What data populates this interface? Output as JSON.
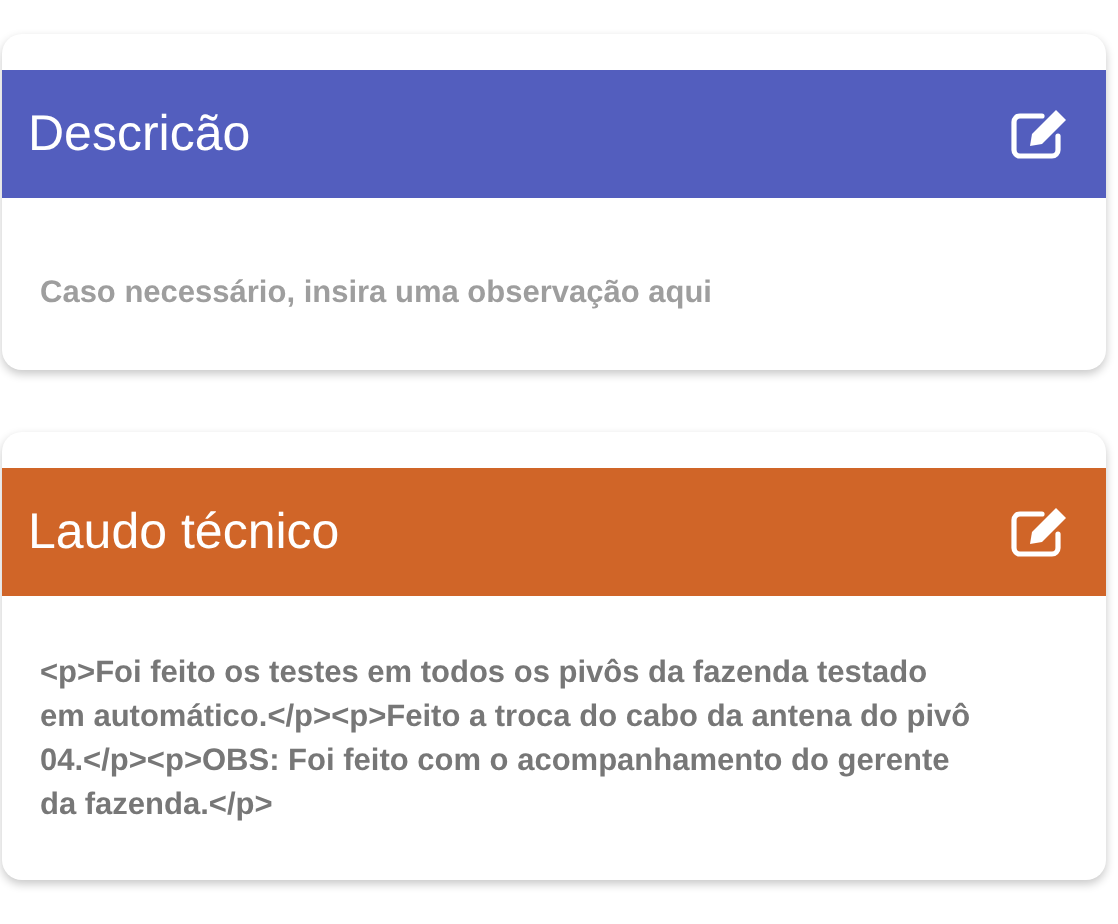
{
  "cards": [
    {
      "title": "Descricão",
      "color": "#535ebe",
      "body": {
        "kind": "placeholder",
        "text": "Caso necessário, insira uma observação aqui"
      }
    },
    {
      "title": "Laudo técnico",
      "color": "#d06528",
      "body": {
        "kind": "text",
        "text": "<p>Foi feito os testes em todos os pivôs da fazenda testado em automático.</p><p>Feito a troca do cabo da antena do pivô 04.</p><p>OBS: Foi feito com o acompanhamento do gerente da fazenda.</p>"
      }
    }
  ]
}
